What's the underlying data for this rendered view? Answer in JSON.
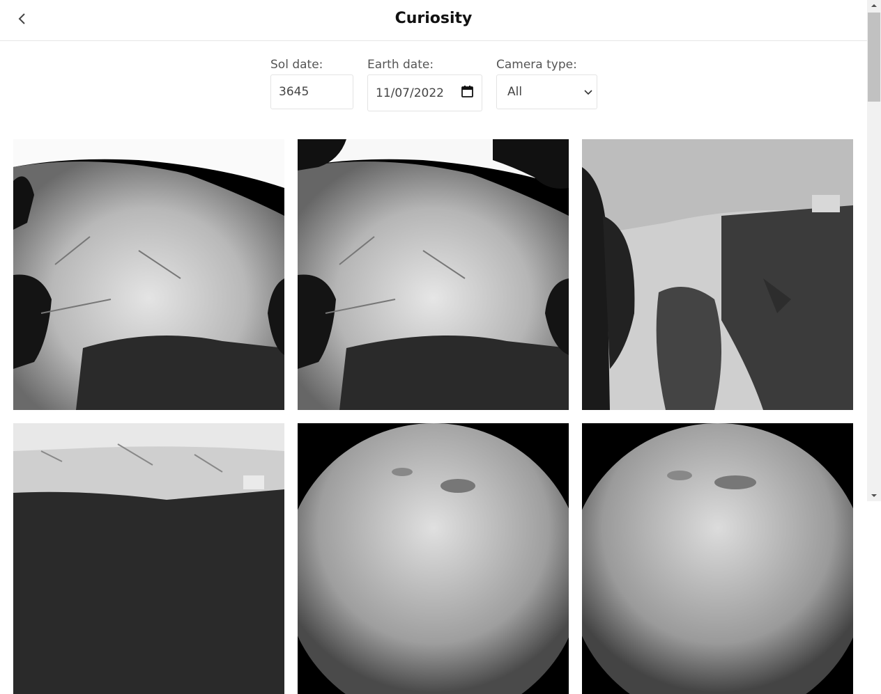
{
  "header": {
    "title": "Curiosity",
    "back_icon": "chevron-left-icon"
  },
  "filters": {
    "sol": {
      "label": "Sol date:",
      "value": "3645"
    },
    "earth": {
      "label": "Earth date:",
      "value": "11/07/2022",
      "icon": "calendar-icon"
    },
    "camera": {
      "label": "Camera type:",
      "selected": "All",
      "icon": "chevron-down-icon"
    }
  },
  "photos": [
    {
      "kind": "rocky-terrain-front"
    },
    {
      "kind": "rocky-terrain-front"
    },
    {
      "kind": "rock-slab-shadow"
    },
    {
      "kind": "rocky-terrain-front"
    },
    {
      "kind": "fisheye-ground"
    },
    {
      "kind": "fisheye-ground"
    }
  ],
  "scrollbar": {
    "up_icon": "scroll-up-arrow-icon",
    "down_icon": "scroll-down-arrow-icon"
  }
}
